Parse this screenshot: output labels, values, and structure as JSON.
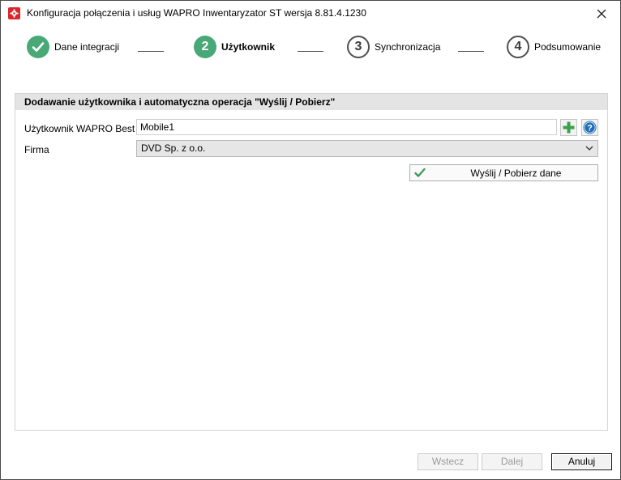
{
  "window": {
    "title": "Konfiguracja połączenia i usług WAPRO Inwentaryzator ST wersja 8.81.4.1230"
  },
  "steps": [
    {
      "number": "",
      "label": "Dane integracji",
      "state": "done"
    },
    {
      "number": "2",
      "label": "Użytkownik",
      "state": "active"
    },
    {
      "number": "3",
      "label": "Synchronizacja",
      "state": "todo"
    },
    {
      "number": "4",
      "label": "Podsumowanie",
      "state": "todo"
    }
  ],
  "panel": {
    "header": "Dodawanie użytkownika i automatyczna operacja \"Wyślij / Pobierz\"",
    "user_label": "Użytkownik WAPRO Best",
    "user_value": "Mobile1",
    "firm_label": "Firma",
    "firm_value": "DVD Sp. z o.o.",
    "send_button": "Wyślij / Pobierz dane"
  },
  "footer": {
    "back": "Wstecz",
    "next": "Dalej",
    "cancel": "Anuluj"
  },
  "colors": {
    "accent_green": "#48a876",
    "help_blue": "#1e6fb8",
    "app_red": "#d9282b"
  },
  "icons": {
    "app": "app-gear-icon",
    "close": "close-icon",
    "add": "plus-icon",
    "help": "help-icon",
    "dropdown": "chevron-down-icon",
    "send": "checkmark-icon"
  }
}
